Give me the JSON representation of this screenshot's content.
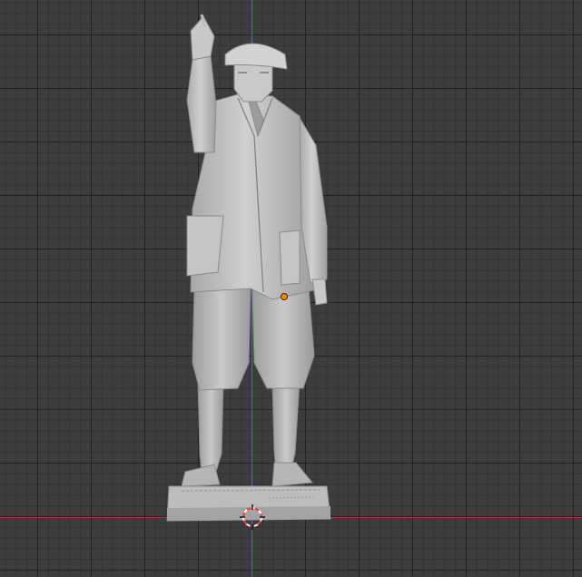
{
  "viewport": {
    "type": "3d-viewport",
    "object": "statue-mesh",
    "colors": {
      "background": "#3d3d3d",
      "axis_x": "#b04545",
      "axis_y": "#4f7bc8",
      "origin_dot": "#ff8a00",
      "mesh": "#c2c2c2"
    }
  },
  "icons": {
    "origin": "origin-dot",
    "cursor": "3d-cursor-icon"
  }
}
